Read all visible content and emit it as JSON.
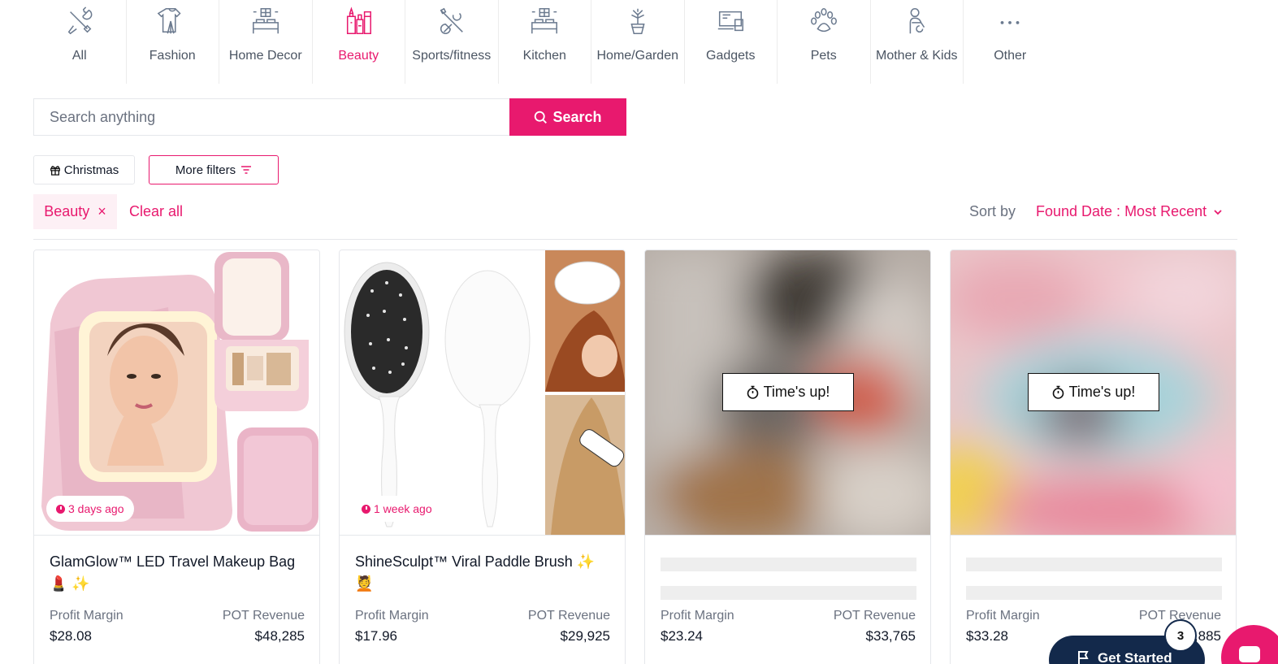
{
  "categories": [
    {
      "label": "All",
      "icon": "tools-icon",
      "active": false
    },
    {
      "label": "Fashion",
      "icon": "clothes-icon",
      "active": false
    },
    {
      "label": "Home Decor",
      "icon": "bedroom-icon",
      "active": false
    },
    {
      "label": "Beauty",
      "icon": "cosmetics-icon",
      "active": true
    },
    {
      "label": "Sports/fitness",
      "icon": "sports-icon",
      "active": false
    },
    {
      "label": "Kitchen",
      "icon": "kitchen-icon",
      "active": false
    },
    {
      "label": "Home/Garden",
      "icon": "plant-icon",
      "active": false
    },
    {
      "label": "Gadgets",
      "icon": "devices-icon",
      "active": false
    },
    {
      "label": "Pets",
      "icon": "paw-icon",
      "active": false
    },
    {
      "label": "Mother & Kids",
      "icon": "mother-icon",
      "active": false
    },
    {
      "label": "Other",
      "icon": "more-dots-icon",
      "active": false
    }
  ],
  "search": {
    "placeholder": "Search anything",
    "button_label": "Search"
  },
  "filters": {
    "christmas_label": "Christmas",
    "more_filters_label": "More filters"
  },
  "active_filters": {
    "tag": "Beauty",
    "remove": "×",
    "clear_all": "Clear all"
  },
  "sort": {
    "label": "Sort by",
    "value": "Found Date : Most Recent"
  },
  "products": [
    {
      "title": "GlamGlow™ LED Travel Makeup Bag",
      "emoji": "💄 ✨",
      "age": "3 days ago",
      "margin_label": "Profit Margin",
      "margin": "$28.08",
      "revenue_label": "POT Revenue",
      "revenue": "$48,285"
    },
    {
      "title": "ShineSculpt™ Viral Paddle Brush",
      "emoji_inline": "✨",
      "emoji": "💆",
      "age": "1 week ago",
      "margin_label": "Profit Margin",
      "margin": "$17.96",
      "revenue_label": "POT Revenue",
      "revenue": "$29,925"
    },
    {
      "locked_label": "Time's up!",
      "margin_label": "Profit Margin",
      "margin": "$23.24",
      "revenue_label": "POT Revenue",
      "revenue": "$33,765"
    },
    {
      "locked_label": "Time's up!",
      "margin_label": "Profit Margin",
      "margin": "$33.28",
      "revenue_label": "POT Revenue",
      "revenue": "$33,885"
    }
  ],
  "widgets": {
    "get_started": "Get Started",
    "count": "3"
  },
  "colors": {
    "accent": "#e8196e",
    "navy": "#13294b"
  }
}
